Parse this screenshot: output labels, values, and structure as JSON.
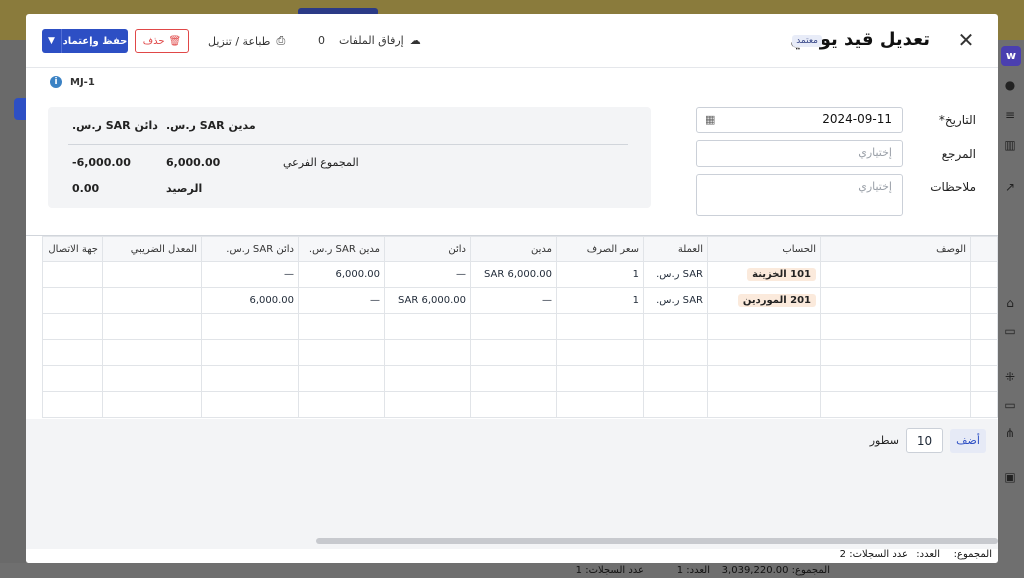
{
  "modal": {
    "title": "تعديل قيد يومي",
    "status_badge": "معتمد",
    "attach_label": "إرفاق الملفات",
    "attach_count": "0",
    "print_label": "طباعة / تنزيل",
    "delete_label": "حذف",
    "save_label": "حفظ وإعتماد",
    "ref_code": "MJ-1"
  },
  "form": {
    "date_label": "التاريخ*",
    "date_value": "2024-09-11",
    "ref_label": "المرجع",
    "ref_placeholder": "إختياري",
    "notes_label": "ملاحظات",
    "notes_placeholder": "إختياري"
  },
  "summary": {
    "debit_header": "مدين SAR ر.س.",
    "credit_header": "دائن SAR ر.س.",
    "subtotal_label": "المجموع الفرعي",
    "subtotal_debit": "6,000.00",
    "subtotal_credit": "-6,000.00",
    "balance_label": "الرصيد",
    "balance_value": "0.00"
  },
  "table": {
    "headers": {
      "description": "الوصف",
      "account": "الحساب",
      "currency": "العملة",
      "rate": "سعر الصرف",
      "debit": "مدين",
      "credit": "دائن",
      "debit_sar": "مدين SAR ر.س.",
      "credit_sar": "دائن SAR ر.س.",
      "tax_rate": "المعدل الضريبي",
      "contact": "جهة الاتصال"
    },
    "rows": [
      {
        "description": "",
        "account": "101 الخزينة",
        "currency": "SAR ر.س.",
        "rate": "1",
        "debit": "SAR 6,000.00",
        "credit": "—",
        "debit_sar": "6,000.00",
        "credit_sar": "—",
        "tax_rate": "",
        "contact": ""
      },
      {
        "description": "",
        "account": "201 الموردين",
        "currency": "SAR ر.س.",
        "rate": "1",
        "debit": "—",
        "credit": "SAR 6,000.00",
        "debit_sar": "—",
        "credit_sar": "6,000.00",
        "tax_rate": "",
        "contact": ""
      }
    ]
  },
  "pager": {
    "add_label": "أضف",
    "rows_value": "10",
    "rows_label": "سطور"
  },
  "footer": {
    "total_label": "المجموع:",
    "count_label": "العدد:",
    "records_label": "عدد السجلات: 2"
  },
  "background": {
    "bottom_total": "المجموع: 3,039,220.00",
    "bottom_count": "العدد: 1",
    "bottom_records": "عدد السجلات: 1"
  }
}
